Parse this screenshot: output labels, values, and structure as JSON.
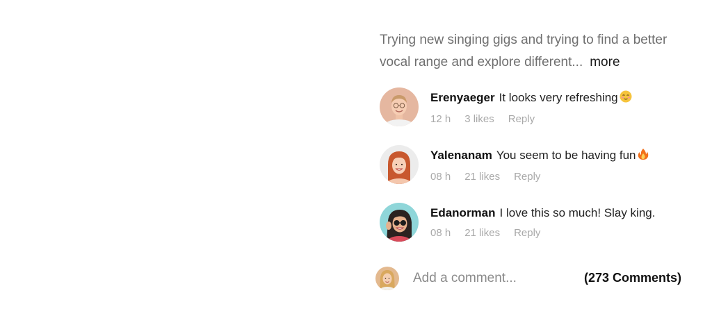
{
  "post": {
    "caption_line1": "Trying new singing gigs and trying to find a better",
    "caption_line2": "vocal range and explore different...",
    "more_label": "more"
  },
  "comments": [
    {
      "user": "Erenyaeger",
      "text": "It looks very refreshing",
      "emoji": "relieved-face-icon",
      "time": "12 h",
      "likes": "3 likes",
      "reply": "Reply"
    },
    {
      "user": "Yalenanam",
      "text": "You seem to be having fun",
      "emoji": "fire-icon",
      "time": "08 h",
      "likes": "21 likes",
      "reply": "Reply"
    },
    {
      "user": "Edanorman",
      "text": "I love this so much! Slay king.",
      "emoji": null,
      "time": "08 h",
      "likes": "21 likes",
      "reply": "Reply"
    }
  ],
  "add_comment": {
    "placeholder": "Add a comment...",
    "count_label": "(273 Comments)"
  },
  "colors": {
    "caption": "#6f6f6f",
    "meta": "#a9a9a9",
    "username": "#111111"
  }
}
